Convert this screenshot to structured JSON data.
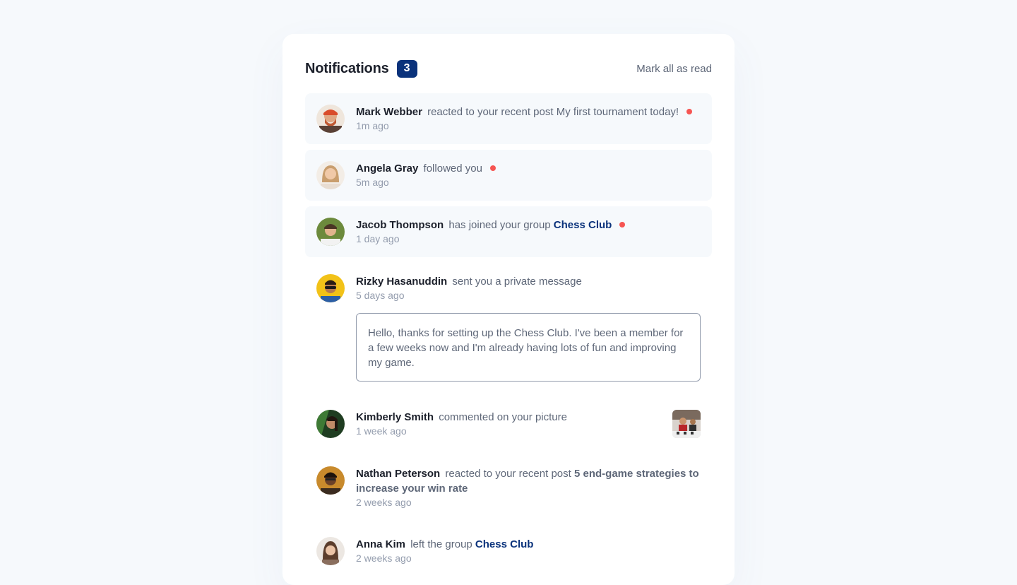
{
  "header": {
    "title": "Notifications",
    "unread_count": "3",
    "mark_all_label": "Mark all as read"
  },
  "notifications": [
    {
      "name": "Mark Webber",
      "action": "reacted to your recent post",
      "target": "My first tournament today!",
      "time": "1m ago",
      "unread": true
    },
    {
      "name": "Angela Gray",
      "action": "followed you",
      "time": "5m ago",
      "unread": true
    },
    {
      "name": "Jacob Thompson",
      "action": "has joined your group",
      "target": "Chess Club",
      "time": "1 day ago",
      "unread": true
    },
    {
      "name": "Rizky Hasanuddin",
      "action": "sent you a private message",
      "time": "5 days ago",
      "unread": false,
      "message": "Hello, thanks for setting up the Chess Club. I've been a member for a few weeks now and I'm already having lots of fun and improving my game."
    },
    {
      "name": "Kimberly Smith",
      "action": "commented on your picture",
      "time": "1 week ago",
      "unread": false
    },
    {
      "name": "Nathan Peterson",
      "action": "reacted to your recent post",
      "target": "5 end-game strategies to increase your win rate",
      "time": "2 weeks ago",
      "unread": false
    },
    {
      "name": "Anna Kim",
      "action": "left the group",
      "target": "Chess Club",
      "time": "2 weeks ago",
      "unread": false
    }
  ],
  "colors": {
    "background": "#f6f9fc",
    "badge": "#0a327b",
    "unread_dot": "#f65552",
    "group_link": "#0a327b"
  },
  "icons": {
    "avatar": "user-avatar-icon",
    "picture": "picture-thumbnail-icon",
    "unread": "unread-dot-icon"
  }
}
